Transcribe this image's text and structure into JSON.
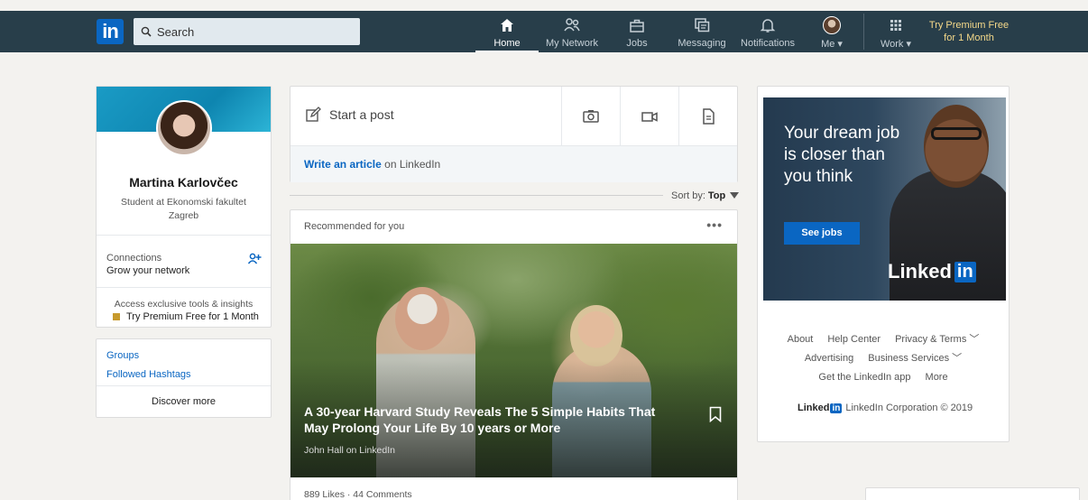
{
  "brand": {
    "logo_text": "in",
    "accent": "#0a66c2",
    "nav_bg": "#283e4a"
  },
  "search": {
    "placeholder": "Search"
  },
  "nav": {
    "home": "Home",
    "network": "My Network",
    "jobs": "Jobs",
    "messaging": "Messaging",
    "notifications": "Notifications",
    "me": "Me",
    "work": "Work",
    "premium_line1": "Try Premium Free",
    "premium_line2": "for 1 Month"
  },
  "profile": {
    "name": "Martina Karlovčec",
    "headline_line1": "Student at Ekonomski fakultet",
    "headline_line2": "Zagreb",
    "connections_label": "Connections",
    "connections_sub": "Grow your network",
    "access_text": "Access exclusive tools & insights",
    "premium_cta": "Try Premium Free for 1 Month"
  },
  "groups": {
    "groups_link": "Groups",
    "hashtags_link": "Followed Hashtags",
    "discover": "Discover more"
  },
  "share": {
    "start_post": "Start a post",
    "write_article": "Write an article",
    "on_linkedin": " on LinkedIn"
  },
  "sort": {
    "label": "Sort by:",
    "value": "Top"
  },
  "feed": {
    "recommended": "Recommended for you",
    "menu": "•••",
    "headline": "A 30-year Harvard Study Reveals The 5 Simple Habits That May Prolong Your Life By 10 years or More",
    "author": "John Hall on LinkedIn",
    "stats": "889 Likes · 44 Comments"
  },
  "ad": {
    "text": "Your dream job is closer than you think",
    "cta": "See jobs",
    "logo_word": "Linked",
    "logo_in": "in"
  },
  "footer": {
    "about": "About",
    "help": "Help Center",
    "privacy": "Privacy & Terms ﹀",
    "advertising": "Advertising",
    "business": "Business Services ﹀",
    "app": "Get the LinkedIn app",
    "more": "More",
    "brand_word": "Linked",
    "brand_in": "in",
    "copyright": "LinkedIn Corporation © 2019"
  }
}
